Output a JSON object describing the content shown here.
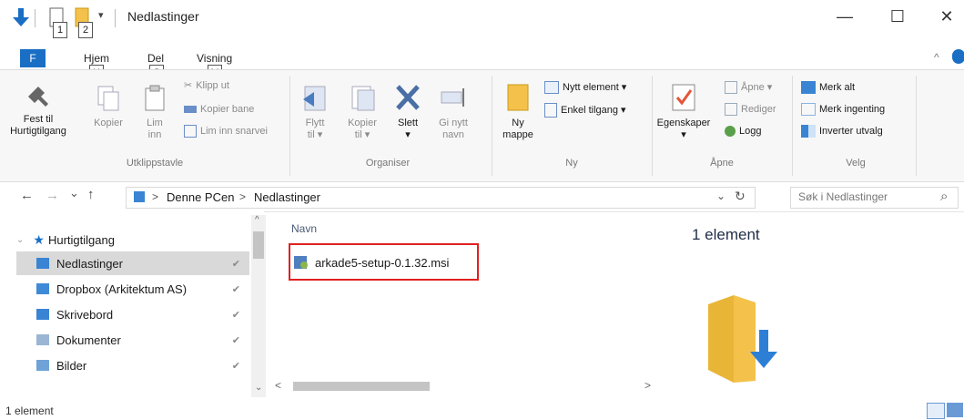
{
  "window": {
    "title": "Nedlastinger",
    "minimize_glyph": "—",
    "maximize_glyph": "☐",
    "close_glyph": "✕"
  },
  "qat": {
    "keytip1": "1",
    "keytip2": "2",
    "dropdown": "▾"
  },
  "tabs": [
    {
      "label": "F",
      "keytip": ""
    },
    {
      "label": "Hjem",
      "keytip": "H"
    },
    {
      "label": "Del",
      "keytip": "S"
    },
    {
      "label": "Visning",
      "keytip": "V"
    }
  ],
  "ribbon": {
    "clipboard": {
      "pin": "Fest til\nHurtigtilgang",
      "copy": "Kopier",
      "paste": "Lim\ninn",
      "cut": "Klipp ut",
      "copy_path": "Kopier bane",
      "paste_shortcut": "Lim inn snarvei",
      "group": "Utklippstavle"
    },
    "organize": {
      "move": "Flytt\ntil ▾",
      "copy_to": "Kopier\ntil ▾",
      "delete": "Slett\n▾",
      "rename": "Gi nytt\nnavn",
      "group": "Organiser"
    },
    "new": {
      "new_folder": "Ny\nmappe",
      "new_item": "Nytt element ▾",
      "easy_access": "Enkel tilgang ▾",
      "group": "Ny"
    },
    "open": {
      "properties": "Egenskaper\n▾",
      "open": "Åpne ▾",
      "edit": "Rediger",
      "history": "Logg",
      "group": "Åpne"
    },
    "select": {
      "select_all": "Merk alt",
      "select_none": "Merk ingenting",
      "invert": "Inverter utvalg",
      "group": "Velg"
    }
  },
  "address": {
    "back": "←",
    "forward": "→",
    "recent": "⌄",
    "up": "↑",
    "sep": ">",
    "crumb1": "Denne PCen",
    "crumb2": "Nedlastinger",
    "dropdown": "⌄",
    "refresh": "↻",
    "search_placeholder": "Søk i Nedlastinger",
    "search_icon": "⌕"
  },
  "nav": {
    "quick_access": "Hurtigtilgang",
    "items": [
      {
        "label": "Nedlastinger",
        "pin": "✔"
      },
      {
        "label": "Dropbox (Arkitektum AS)",
        "pin": "✔"
      },
      {
        "label": "Skrivebord",
        "pin": "✔"
      },
      {
        "label": "Dokumenter",
        "pin": "✔"
      },
      {
        "label": "Bilder",
        "pin": "✔"
      }
    ]
  },
  "files": {
    "column_name": "Navn",
    "items": [
      {
        "name": "arkade5-setup-0.1.32.msi"
      }
    ]
  },
  "preview": {
    "count": "1 element"
  },
  "status": {
    "count": "1 element"
  },
  "colors": {
    "accent": "#1a6fc4",
    "highlight": "#e02020",
    "folder": "#f4c24b"
  }
}
